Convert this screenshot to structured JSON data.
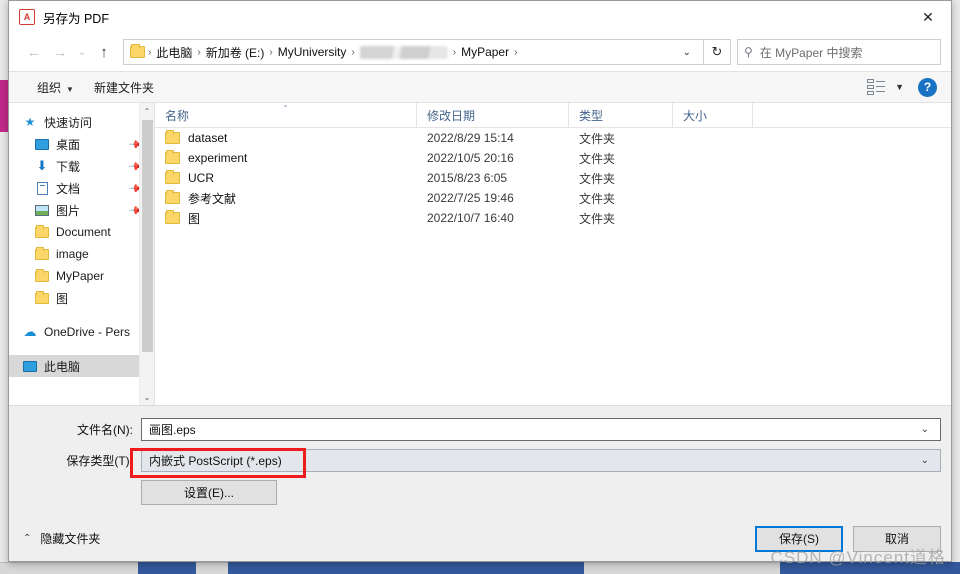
{
  "window": {
    "title": "另存为 PDF",
    "pdf_icon": "pdf-file-icon",
    "close_label": "✕"
  },
  "nav": {
    "back": "←",
    "forward": "→",
    "recent": "⌄",
    "up": "↑",
    "breadcrumbs": [
      {
        "label": "此电脑"
      },
      {
        "label": "新加卷 (E:)"
      },
      {
        "label": "MyUniversity"
      },
      {
        "label": "",
        "redacted": true
      },
      {
        "label": "MyPaper"
      }
    ],
    "separator": "›",
    "dropdown_caret": "⌄",
    "refresh": "↻",
    "search": {
      "icon": "search-icon",
      "placeholder": "在 MyPaper 中搜索",
      "value": "在 MyPaper 中搜索"
    }
  },
  "toolbar": {
    "organize": "组织",
    "organize_caret": "▼",
    "new_folder": "新建文件夹",
    "view_caret": "▼",
    "help": "?"
  },
  "sidebar": {
    "items": [
      {
        "label": "快速访问",
        "icon": "star-icon",
        "indent": false,
        "pinned": false,
        "selected": false
      },
      {
        "label": "桌面",
        "icon": "desktop-icon",
        "indent": true,
        "pinned": true,
        "selected": false
      },
      {
        "label": "下载",
        "icon": "download-icon",
        "indent": true,
        "pinned": true,
        "selected": false
      },
      {
        "label": "文档",
        "icon": "document-icon",
        "indent": true,
        "pinned": true,
        "selected": false
      },
      {
        "label": "图片",
        "icon": "picture-icon",
        "indent": true,
        "pinned": true,
        "selected": false
      },
      {
        "label": "Document",
        "icon": "folder-icon",
        "indent": true,
        "pinned": false,
        "selected": false
      },
      {
        "label": "image",
        "icon": "folder-icon",
        "indent": true,
        "pinned": false,
        "selected": false
      },
      {
        "label": "MyPaper",
        "icon": "folder-icon",
        "indent": true,
        "pinned": false,
        "selected": false
      },
      {
        "label": "图",
        "icon": "folder-icon",
        "indent": true,
        "pinned": false,
        "selected": false
      },
      {
        "label": "OneDrive - Pers",
        "icon": "cloud-icon",
        "indent": false,
        "pinned": false,
        "selected": false
      },
      {
        "label": "此电脑",
        "icon": "pc-icon",
        "indent": false,
        "pinned": false,
        "selected": true
      }
    ],
    "pin_glyph": "📌",
    "scroll_up": "⌃",
    "scroll_down": "⌄"
  },
  "filelist": {
    "columns": [
      {
        "label": "名称",
        "sorted": true,
        "sort_caret": "⌃"
      },
      {
        "label": "修改日期",
        "sorted": false,
        "sort_caret": ""
      },
      {
        "label": "类型",
        "sorted": false,
        "sort_caret": ""
      },
      {
        "label": "大小",
        "sorted": false,
        "sort_caret": ""
      }
    ],
    "rows": [
      {
        "name": "dataset",
        "date": "2022/8/29 15:14",
        "type": "文件夹",
        "size": ""
      },
      {
        "name": "experiment",
        "date": "2022/10/5 20:16",
        "type": "文件夹",
        "size": ""
      },
      {
        "name": "UCR",
        "date": "2015/8/23 6:05",
        "type": "文件夹",
        "size": ""
      },
      {
        "name": "参考文献",
        "date": "2022/7/25 19:46",
        "type": "文件夹",
        "size": ""
      },
      {
        "name": "图",
        "date": "2022/10/7 16:40",
        "type": "文件夹",
        "size": ""
      }
    ]
  },
  "form": {
    "filename_label": "文件名(N):",
    "filename_value": "画图.eps",
    "filetype_label": "保存类型(T):",
    "filetype_value": "内嵌式 PostScript (*.eps)",
    "settings_button": "设置(E)...",
    "combo_caret": "⌄"
  },
  "footer": {
    "hide_folders": "隐藏文件夹",
    "hide_chevron": "⌃",
    "save_button": "保存(S)",
    "cancel_button": "取消"
  },
  "annotation": {
    "highlight_color": "#ee1c1c"
  },
  "watermark": {
    "text": "CSDN @Vincent道格"
  }
}
